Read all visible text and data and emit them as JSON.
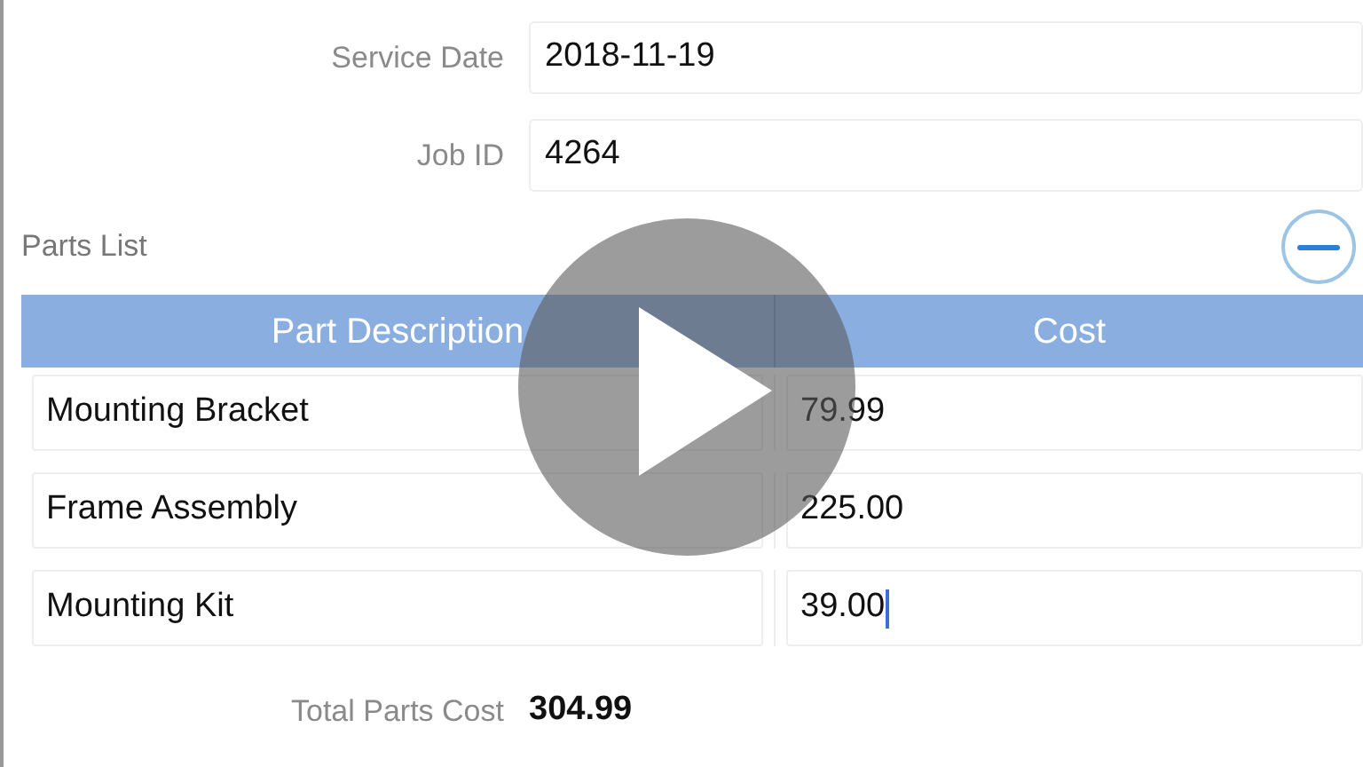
{
  "fields": [
    {
      "label": "Service Date",
      "value": "2018-11-19"
    },
    {
      "label": "Job ID",
      "value": "4264"
    }
  ],
  "parts_list": {
    "title": "Parts List",
    "columns": [
      "Part Description",
      "Cost"
    ],
    "rows": [
      {
        "description": "Mounting Bracket",
        "cost": "79.99",
        "focused": false
      },
      {
        "description": "Frame Assembly",
        "cost": "225.00",
        "focused": false
      },
      {
        "description": "Mounting Kit",
        "cost": "39.00",
        "focused": true
      }
    ]
  },
  "total": {
    "label": "Total Parts Cost",
    "value": "304.99"
  }
}
